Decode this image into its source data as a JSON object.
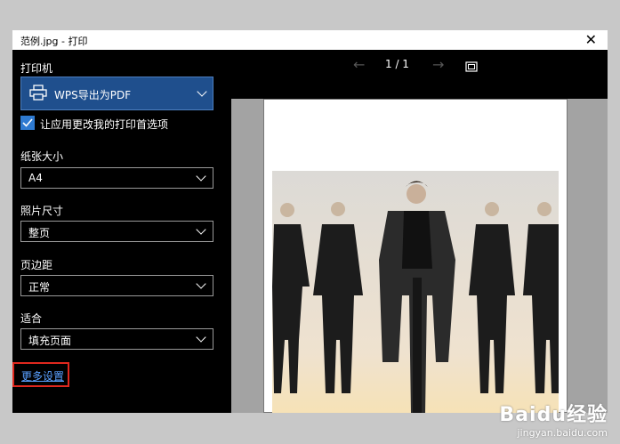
{
  "window": {
    "title": "范例.jpg - 打印",
    "close_glyph": "✕"
  },
  "printer": {
    "label": "打印机",
    "selected": "WPS导出为PDF",
    "icon": "printer-icon",
    "accent": "#1f4f8d"
  },
  "options": {
    "app_prefs_label": "让应用更改我的打印首选项",
    "app_prefs_checked": true
  },
  "paper_size": {
    "label": "纸张大小",
    "value": "A4"
  },
  "photo_size": {
    "label": "照片尺寸",
    "value": "整页"
  },
  "margins": {
    "label": "页边距",
    "value": "正常"
  },
  "fit": {
    "label": "适合",
    "value": "填充页面"
  },
  "more_settings": {
    "label": "更多设置",
    "highlight": "#e0281e"
  },
  "preview": {
    "page_indicator": "1 / 1",
    "prev_icon": "arrow-left-icon",
    "next_icon": "arrow-right-icon",
    "fit_icon": "fit-to-window-icon"
  },
  "watermark": {
    "logo": "Baidu经验",
    "url": "jingyan.baidu.com"
  }
}
